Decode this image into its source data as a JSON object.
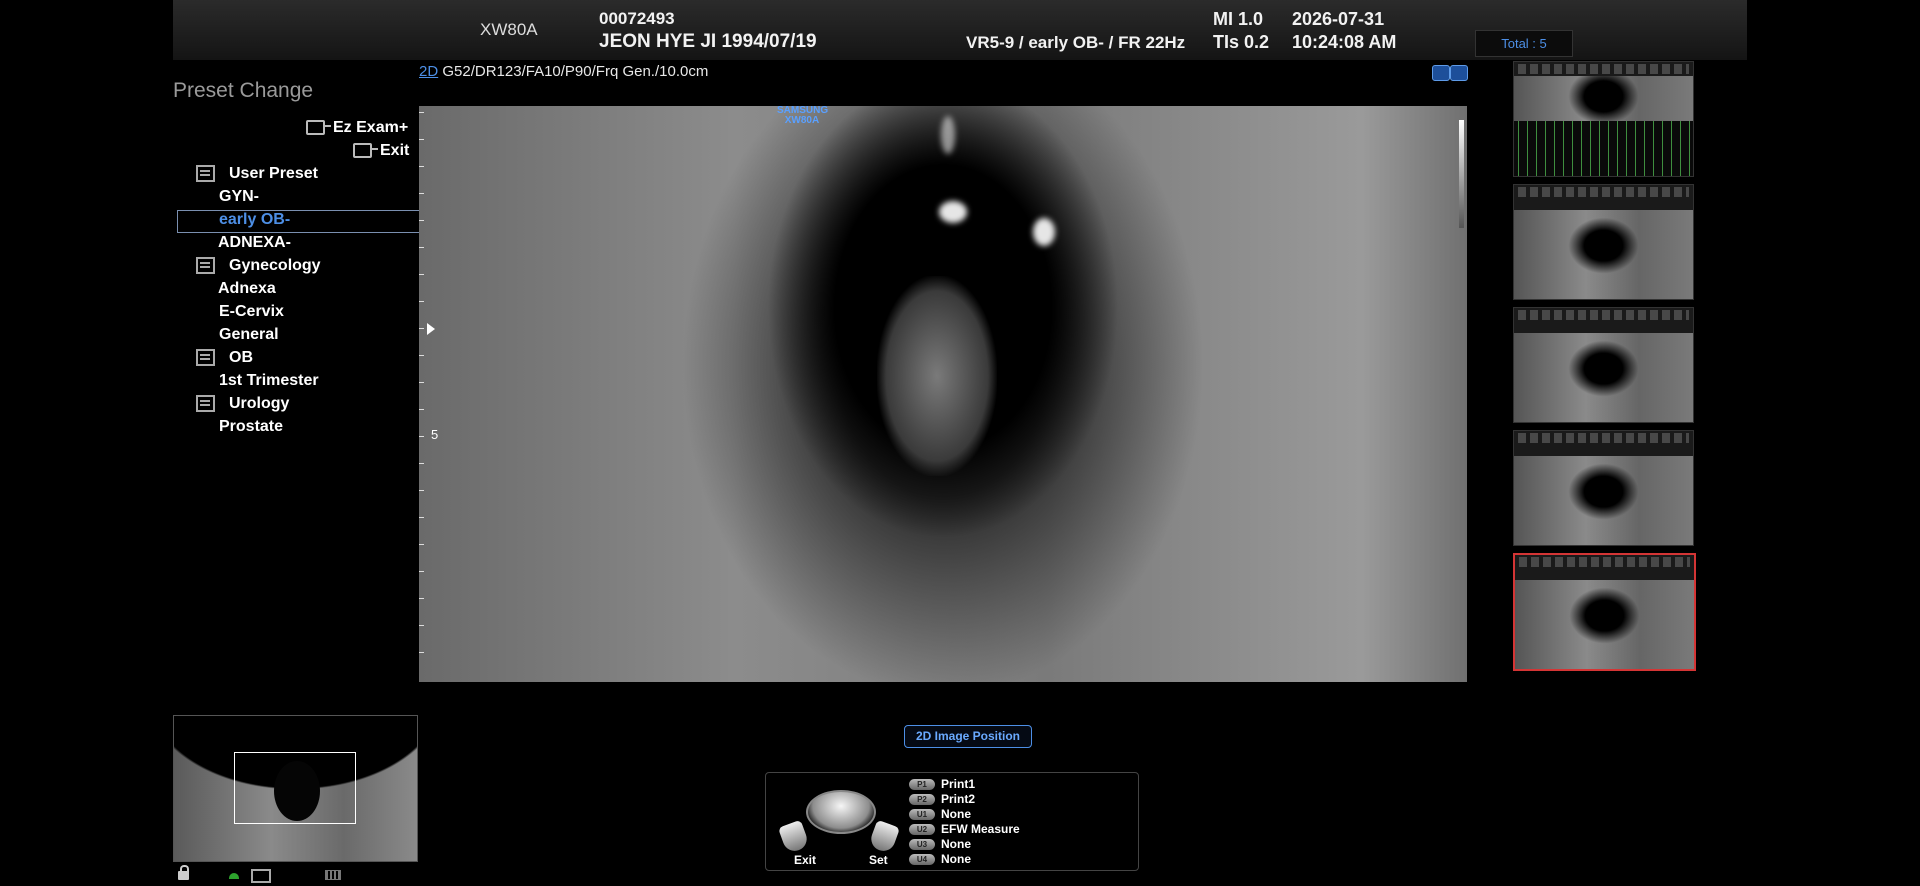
{
  "header": {
    "model": "XW80A",
    "patient_id": "00072493",
    "patient_name_dob": "JEON HYE JI 1994/07/19",
    "probe_preset": "VR5-9 / early OB- / FR 22Hz",
    "mi": "MI  1.0",
    "tis": "TIs 0.2",
    "date": "2026-07-31",
    "time": "10:24:08 AM",
    "total": "Total : 5"
  },
  "preset_panel": {
    "title": "Preset Change",
    "ez_exam": "Ez Exam+",
    "exit": "Exit",
    "groups": [
      {
        "label": "User Preset",
        "items": [
          "GYN-",
          "early OB-",
          "ADNEXA-"
        ]
      },
      {
        "label": "Gynecology",
        "items": [
          "Adnexa",
          "E-Cervix",
          "General"
        ]
      },
      {
        "label": "OB",
        "items": [
          "1st Trimester"
        ]
      },
      {
        "label": "Urology",
        "items": [
          "Prostate"
        ]
      }
    ],
    "selected_item": "early OB-",
    "selected_color": "#4d8fe6"
  },
  "image": {
    "mode": "2D",
    "params": "G52/DR123/FA10/P90/Frq Gen./10.0cm",
    "brand_line1": "SAMSUNG",
    "brand_line2": "XW80A",
    "depth_label": "5"
  },
  "bottom": {
    "position_label": "2D Image Position",
    "exit_label": "Exit",
    "set_label": "Set",
    "keys": [
      {
        "key": "P1",
        "label": "Print1"
      },
      {
        "key": "P2",
        "label": "Print2"
      },
      {
        "key": "U1",
        "label": "None"
      },
      {
        "key": "U2",
        "label": "EFW Measure"
      },
      {
        "key": "U3",
        "label": "None"
      },
      {
        "key": "U4",
        "label": "None"
      }
    ]
  },
  "colors": {
    "accent": "#4d8fe6",
    "selected_thumb_border": "#d43535"
  },
  "icons": [
    "lock-icon",
    "network-icon",
    "window-icon",
    "keyboard-icon",
    "volume-render-icon"
  ]
}
